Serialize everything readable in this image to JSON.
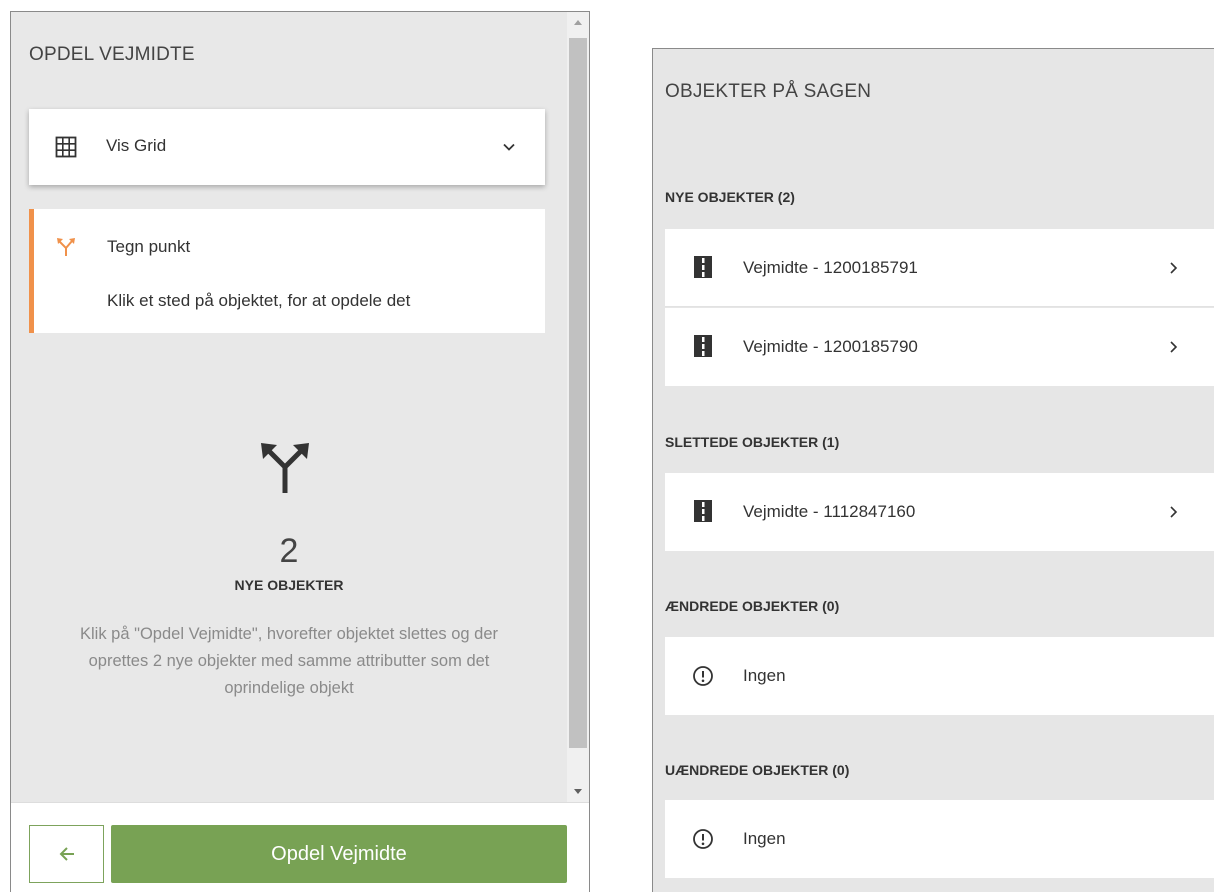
{
  "left_panel": {
    "title": "OPDEL VEJMIDTE",
    "grid_toggle": {
      "label": "Vis Grid",
      "icon": "grid-icon"
    },
    "draw_step": {
      "title": "Tegn punkt",
      "instruction": "Klik et sted på objektet, for at opdele det",
      "accent_color": "#f0914a",
      "icon": "split-arrow-icon"
    },
    "summary": {
      "count": "2",
      "count_label": "NYE OBJEKTER",
      "description": "Klik på \"Opdel Vejmidte\", hvorefter objektet slettes og der oprettes 2 nye objekter med samme attributter som det oprindelige objekt"
    },
    "footer": {
      "back_icon": "arrow-left-icon",
      "primary_label": "Opdel Vejmidte",
      "primary_color": "#78a254"
    }
  },
  "right_panel": {
    "title": "OBJEKTER PÅ SAGEN",
    "sections": [
      {
        "header": "NYE OBJEKTER (2)",
        "items": [
          {
            "label": "Vejmidte - 1200185791",
            "icon": "road-icon"
          },
          {
            "label": "Vejmidte - 1200185790",
            "icon": "road-icon"
          }
        ]
      },
      {
        "header": "SLETTEDE OBJEKTER (1)",
        "items": [
          {
            "label": "Vejmidte - 1112847160",
            "icon": "road-icon"
          }
        ]
      },
      {
        "header": "ÆNDREDE OBJEKTER (0)",
        "items": [
          {
            "label": "Ingen",
            "icon": "alert-circle-icon"
          }
        ]
      },
      {
        "header": "UÆNDREDE OBJEKTER (0)",
        "items": [
          {
            "label": "Ingen",
            "icon": "alert-circle-icon"
          }
        ]
      }
    ]
  }
}
